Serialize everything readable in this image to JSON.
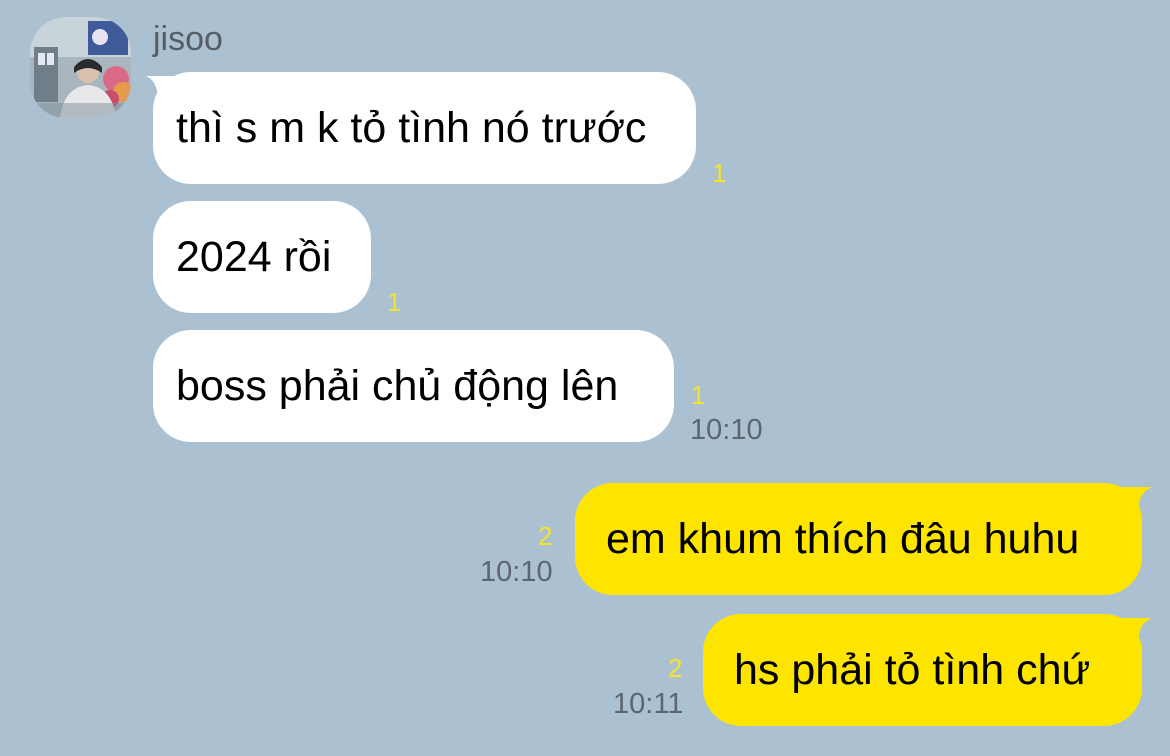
{
  "chat": {
    "sender": {
      "name": "jisoo",
      "avatar_icon": "profile-photo"
    },
    "incoming": [
      {
        "text": "thì s m k tỏ tình nó trước",
        "unread": "1"
      },
      {
        "text": "2024 rồi",
        "unread": "1"
      },
      {
        "text": "boss phải chủ động lên",
        "unread": "1",
        "time": "10:10"
      }
    ],
    "outgoing": [
      {
        "text": "em khum thích đâu huhu",
        "unread": "2",
        "time": "10:10"
      },
      {
        "text": "hs phải tỏ tình chứ",
        "unread": "2",
        "time": "10:11"
      }
    ]
  },
  "colors": {
    "background": "#abc1d1",
    "incoming_bubble": "#ffffff",
    "outgoing_bubble": "#fee500",
    "unread_count": "#f2e52a",
    "timestamp": "#5c6670"
  }
}
